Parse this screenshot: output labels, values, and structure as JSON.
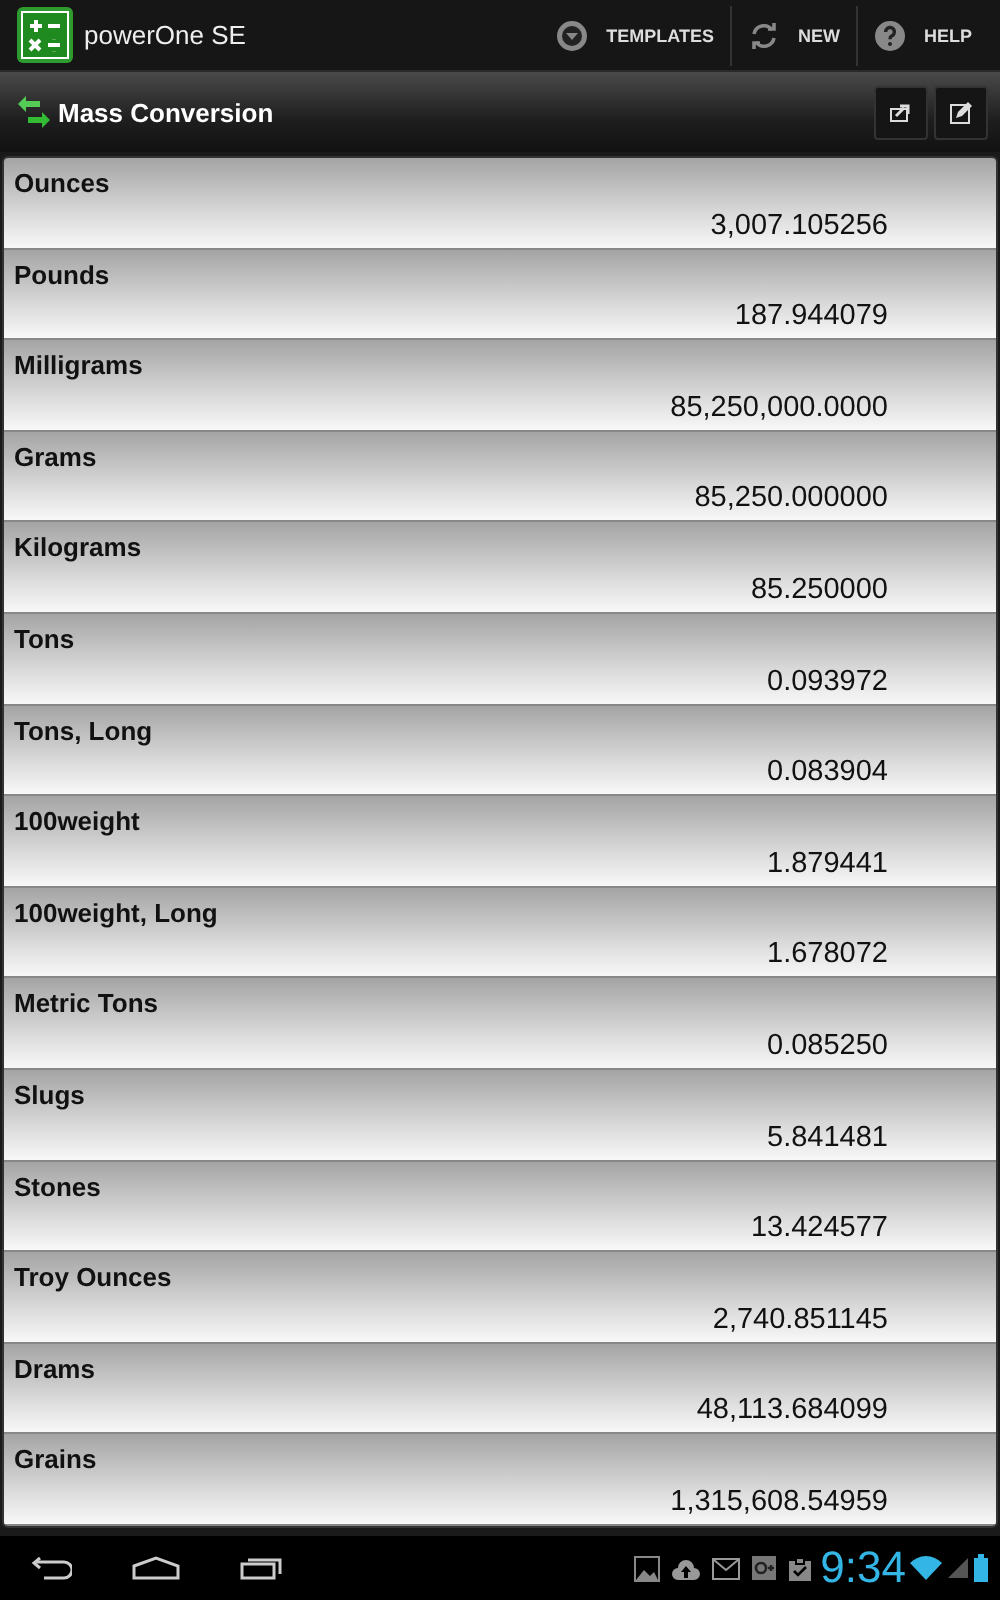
{
  "app_bar": {
    "title": "powerOne SE",
    "actions": [
      {
        "kind": "templates",
        "label": "TEMPLATES"
      },
      {
        "kind": "new",
        "label": "NEW"
      },
      {
        "kind": "help",
        "label": "HELP"
      }
    ]
  },
  "title_bar": {
    "title": "Mass Conversion"
  },
  "rows": [
    {
      "label": "Ounces",
      "value": "3,007.105256"
    },
    {
      "label": "Pounds",
      "value": "187.944079"
    },
    {
      "label": "Milligrams",
      "value": "85,250,000.0000"
    },
    {
      "label": "Grams",
      "value": "85,250.000000"
    },
    {
      "label": "Kilograms",
      "value": "85.250000"
    },
    {
      "label": "Tons",
      "value": "0.093972"
    },
    {
      "label": "Tons, Long",
      "value": "0.083904"
    },
    {
      "label": "100weight",
      "value": "1.879441"
    },
    {
      "label": "100weight, Long",
      "value": "1.678072"
    },
    {
      "label": "Metric Tons",
      "value": "0.085250"
    },
    {
      "label": "Slugs",
      "value": "5.841481"
    },
    {
      "label": "Stones",
      "value": "13.424577"
    },
    {
      "label": "Troy Ounces",
      "value": "2,740.851145"
    },
    {
      "label": "Drams",
      "value": "48,113.684099"
    },
    {
      "label": "Grains",
      "value": "1,315,608.54959"
    }
  ],
  "status_bar": {
    "time": "9:34"
  }
}
